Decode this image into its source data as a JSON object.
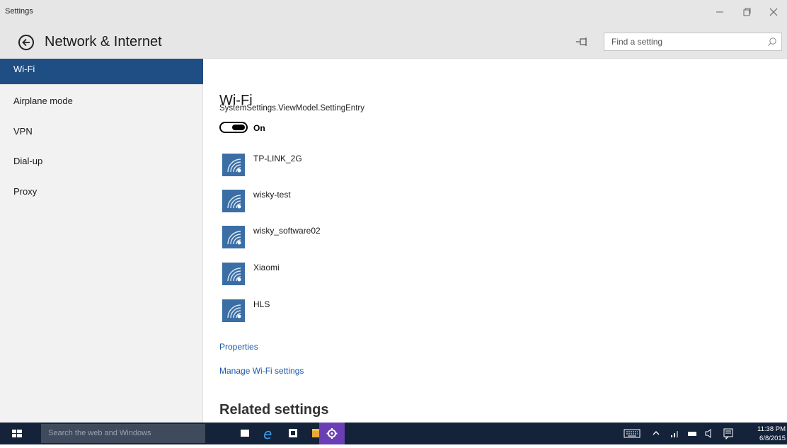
{
  "window": {
    "app_title": "Settings",
    "controls": {
      "minimize": "—",
      "maximize": "☐",
      "close": "✕"
    }
  },
  "header": {
    "title": "Network & Internet",
    "search_placeholder": "Find a setting"
  },
  "sidebar": {
    "items": [
      {
        "label": "Wi-Fi",
        "selected": true
      },
      {
        "label": "Airplane mode",
        "selected": false
      },
      {
        "label": "VPN",
        "selected": false
      },
      {
        "label": "Dial-up",
        "selected": false
      },
      {
        "label": "Proxy",
        "selected": false
      }
    ]
  },
  "main": {
    "section_title": "Wi-Fi",
    "setting_entry": "SystemSettings.ViewModel.SettingEntry",
    "toggle": {
      "state": "On",
      "on": true
    },
    "networks": [
      {
        "name": "TP-LINK_2G"
      },
      {
        "name": "wisky-test"
      },
      {
        "name": "wisky_software02"
      },
      {
        "name": "Xiaomi"
      },
      {
        "name": "HLS"
      }
    ],
    "links": {
      "properties": "Properties",
      "manage": "Manage Wi-Fi settings"
    },
    "related_title": "Related settings"
  },
  "taskbar": {
    "search_placeholder": "Search the web and Windows",
    "apps": [
      "task-view-icon",
      "edge-icon",
      "store-icon",
      "file-explorer-icon",
      "settings-icon"
    ],
    "tray_icons": [
      "keyboard-icon",
      "chevron-up-icon",
      "network-icon",
      "battery-icon",
      "volume-icon",
      "action-center-icon"
    ],
    "time": "11:38 PM",
    "date": "6/8/2015"
  },
  "colors": {
    "accent": "#1f4e84",
    "tile": "#3a6ea5",
    "link": "#1f5aa6",
    "taskbar": "#14233a"
  }
}
